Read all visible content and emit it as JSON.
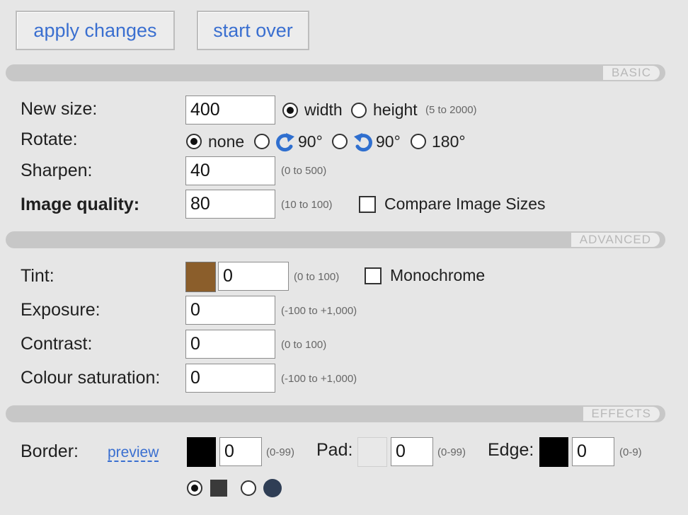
{
  "toolbar": {
    "apply_label": "apply changes",
    "start_over_label": "start over"
  },
  "sections": {
    "basic": "BASIC",
    "advanced": "ADVANCED",
    "effects": "EFFECTS"
  },
  "basic": {
    "new_size": {
      "label": "New size:",
      "value": "400",
      "option_width": "width",
      "option_height": "height",
      "hint": "(5 to 2000)",
      "selected": "width"
    },
    "rotate": {
      "label": "Rotate:",
      "option_none": "none",
      "option_cw": "90°",
      "option_ccw": "90°",
      "option_180": "180°",
      "selected": "none"
    },
    "sharpen": {
      "label": "Sharpen:",
      "value": "40",
      "hint": "(0 to 500)"
    },
    "quality": {
      "label": "Image quality:",
      "value": "80",
      "hint": "(10 to 100)",
      "compare_label": "Compare Image Sizes",
      "compare_checked": false
    }
  },
  "advanced": {
    "tint": {
      "label": "Tint:",
      "color": "#8b5e2b",
      "value": "0",
      "hint": "(0 to 100)",
      "monochrome_label": "Monochrome",
      "monochrome_checked": false
    },
    "exposure": {
      "label": "Exposure:",
      "value": "0",
      "hint": "(-100 to +1,000)"
    },
    "contrast": {
      "label": "Contrast:",
      "value": "0",
      "hint": "(0 to 100)"
    },
    "saturation": {
      "label": "Colour saturation:",
      "value": "0",
      "hint": "(-100 to +1,000)"
    }
  },
  "effects": {
    "border": {
      "label": "Border:",
      "preview_label": "preview",
      "color": "#000000",
      "value": "0",
      "hint": "(0-99)"
    },
    "pad": {
      "label": "Pad:",
      "color": "#e8e8e8",
      "value": "0",
      "hint": "(0-99)"
    },
    "edge": {
      "label": "Edge:",
      "color": "#000000",
      "value": "0",
      "hint": "(0-9)"
    },
    "shape": {
      "selected": "square",
      "square_color": "#3a3a3a",
      "round_color": "#2f3e55"
    }
  }
}
